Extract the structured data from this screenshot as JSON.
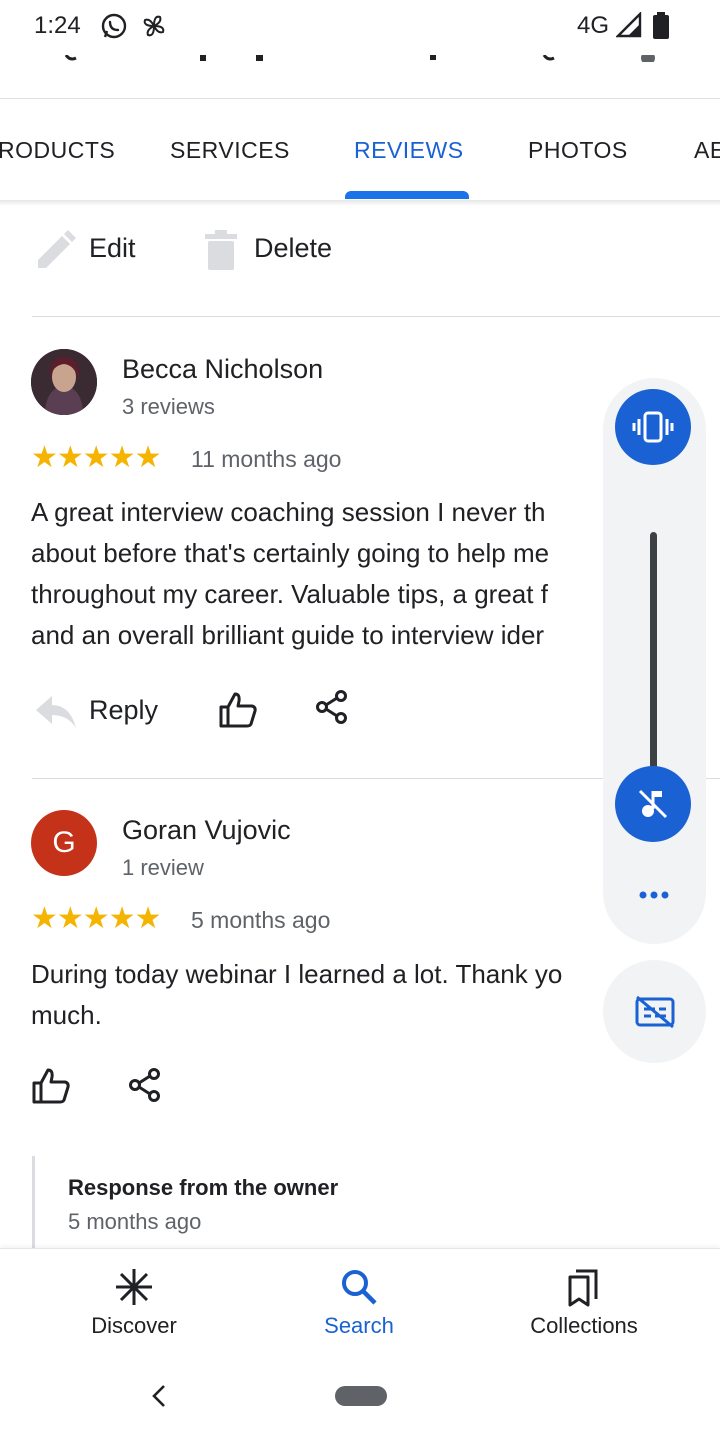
{
  "status_bar": {
    "time": "1:24",
    "network": "4G"
  },
  "tabs": [
    {
      "label": "RODUCTS",
      "active": false
    },
    {
      "label": "SERVICES",
      "active": false
    },
    {
      "label": "REVIEWS",
      "active": true
    },
    {
      "label": "PHOTOS",
      "active": false
    },
    {
      "label": "AE",
      "active": false
    }
  ],
  "own_review_actions": {
    "edit": "Edit",
    "delete": "Delete"
  },
  "reviews": [
    {
      "name": "Becca Nicholson",
      "count": "3 reviews",
      "stars": "★★★★★",
      "rating": 5,
      "time": "11 months ago",
      "lines": [
        "A great interview coaching session I never th",
        "about before that's certainly going to help me",
        "throughout my career. Valuable tips, a great f",
        "and an overall brilliant guide to interview ider"
      ],
      "reply_label": "Reply"
    },
    {
      "name": "Goran Vujovic",
      "initial": "G",
      "count": "1 review",
      "stars": "★★★★★",
      "rating": 5,
      "time": "5 months ago",
      "lines": [
        "During today webinar I learned a lot. Thank yo",
        "much."
      ],
      "owner_response": {
        "title": "Response from the owner",
        "time": "5 months ago"
      }
    }
  ],
  "bottom_nav": [
    {
      "label": "Discover",
      "icon": "discover-icon",
      "active": false
    },
    {
      "label": "Search",
      "icon": "search-icon",
      "active": true
    },
    {
      "label": "Collections",
      "icon": "collections-icon",
      "active": false
    }
  ],
  "colors": {
    "accent": "#1a62d3",
    "star": "#f4b400",
    "goran_avatar": "#c5321a"
  }
}
